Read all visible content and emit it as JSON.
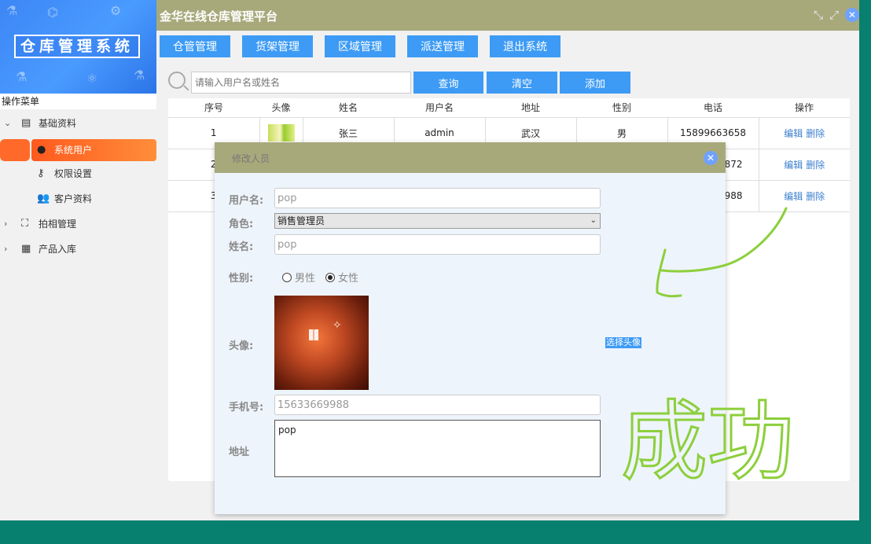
{
  "header": {
    "logo_title": "仓库管理系统",
    "platform_title": "金华在线仓库管理平台"
  },
  "nav": [
    {
      "label": "仓管管理"
    },
    {
      "label": "货架管理"
    },
    {
      "label": "区域管理"
    },
    {
      "label": "派送管理"
    },
    {
      "label": "退出系统"
    }
  ],
  "sidebar": {
    "heading": "操作菜单",
    "groups": [
      {
        "label": "基础资料",
        "icon": "folder-icon",
        "expanded": true
      },
      {
        "label": "拍相管理",
        "icon": "person-frame-icon",
        "expanded": false
      },
      {
        "label": "产品入库",
        "icon": "grid-icon",
        "expanded": false
      }
    ],
    "items": [
      {
        "label": "系统用户",
        "icon": "user-icon",
        "active": true
      },
      {
        "label": "权限设置",
        "icon": "user-key-icon"
      },
      {
        "label": "客户资料",
        "icon": "users-icon"
      }
    ]
  },
  "search": {
    "placeholder": "请输入用户名或姓名",
    "query_label": "查询",
    "clear_label": "清空",
    "add_label": "添加"
  },
  "table": {
    "columns": [
      "序号",
      "头像",
      "姓名",
      "用户名",
      "地址",
      "性别",
      "电话",
      "操作"
    ],
    "rows": [
      {
        "no": "1",
        "name": "张三",
        "username": "admin",
        "address": "武汉",
        "gender": "男",
        "phone": "15899663658"
      },
      {
        "no": "2",
        "name": "",
        "username": "",
        "address": "",
        "gender": "",
        "phone": "872"
      },
      {
        "no": "3",
        "name": "",
        "username": "",
        "address": "",
        "gender": "",
        "phone": "988"
      }
    ],
    "edit_label": "编辑",
    "delete_label": "删除"
  },
  "modal": {
    "title": "修改人员",
    "username_label": "用户名:",
    "username_value": "pop",
    "role_label": "角色:",
    "role_value": "销售管理员",
    "name_label": "姓名:",
    "name_value": "pop",
    "gender_label": "性别:",
    "gender_male": "男性",
    "gender_female": "女性",
    "gender_selected": "女性",
    "avatar_label": "头像:",
    "choose_avatar_label": "选择头像",
    "phone_label": "手机号:",
    "phone_value": "15633669988",
    "address_label": "地址",
    "address_value": "pop"
  },
  "annotation": {
    "text": "成功",
    "color": "#8ccf3c"
  },
  "colors": {
    "accent": "#3d9bf5",
    "header": "#a8a97b",
    "active_item": "#ff6a2a",
    "frame": "#088070"
  }
}
